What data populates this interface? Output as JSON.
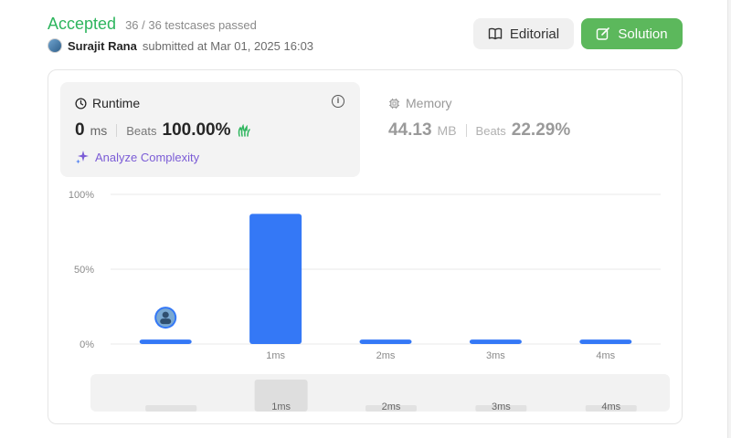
{
  "submission": {
    "status": "Accepted",
    "tests": "36 / 36 testcases passed",
    "user": "Surajit Rana",
    "submitted_text": "submitted at Mar 01, 2025 16:03"
  },
  "buttons": {
    "editorial": "Editorial",
    "solution": "Solution"
  },
  "runtime": {
    "title": "Runtime",
    "value": "0",
    "unit": "ms",
    "beats_label": "Beats",
    "beats_value": "100.00%",
    "analyze_label": "Analyze Complexity"
  },
  "memory": {
    "title": "Memory",
    "value": "44.13",
    "unit": "MB",
    "beats_label": "Beats",
    "beats_value": "22.29%"
  },
  "colors": {
    "accepted": "#2db55d",
    "bar": "#3478f6",
    "solution_button": "#5cb85c",
    "analyze": "#7b5cd6"
  },
  "chart_data": {
    "type": "bar",
    "categories": [
      "",
      "1ms",
      "2ms",
      "3ms",
      "4ms"
    ],
    "values": [
      3,
      87,
      3,
      3,
      3
    ],
    "yticks": [
      "0%",
      "50%",
      "100%"
    ],
    "ylim": [
      0,
      100
    ],
    "grid": true,
    "user_marker_index": 0,
    "mini_categories": [
      "",
      "1ms",
      "2ms",
      "3ms",
      "4ms"
    ],
    "mini_selected_index": 1
  }
}
